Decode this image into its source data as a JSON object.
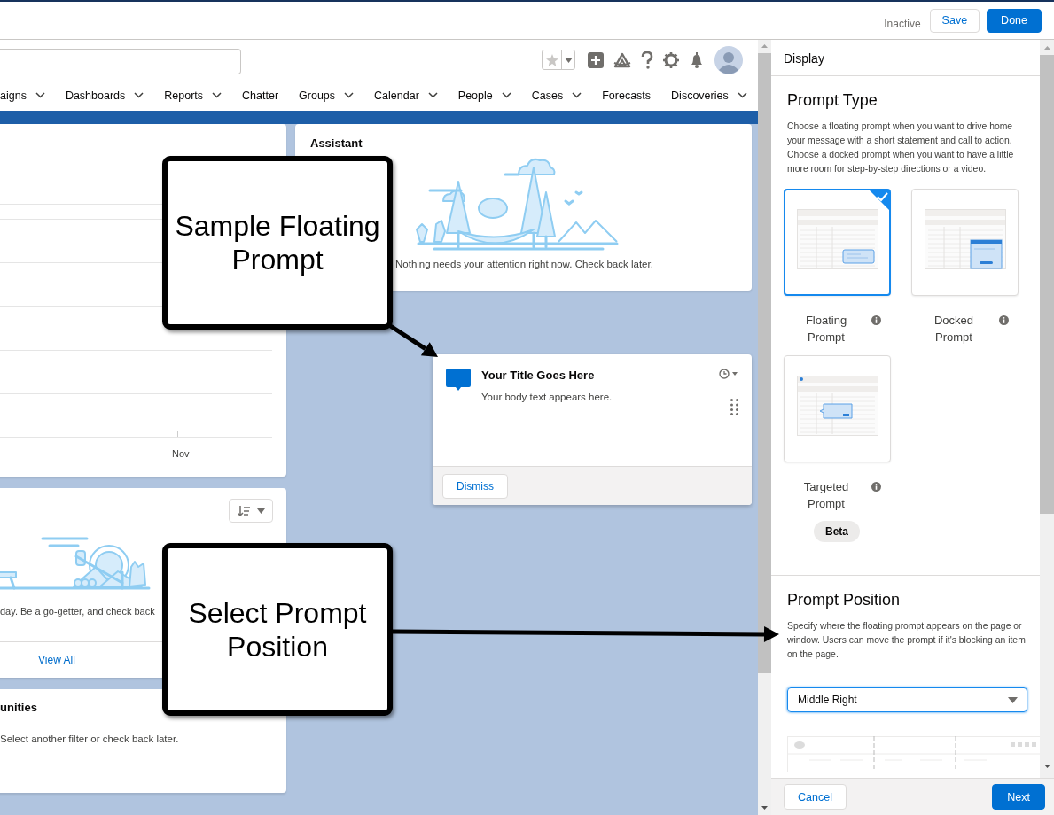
{
  "top_bar": {
    "status": "Inactive",
    "buttons": [
      {
        "label": "Save",
        "kind": "secondary"
      },
      {
        "label": "Done",
        "kind": "primary"
      }
    ]
  },
  "app_preview": {
    "nav_items": [
      {
        "label": "aigns",
        "has_menu": true
      },
      {
        "label": "Dashboards",
        "has_menu": true
      },
      {
        "label": "Reports",
        "has_menu": true
      },
      {
        "label": "Chatter",
        "has_menu": false
      },
      {
        "label": "Groups",
        "has_menu": true
      },
      {
        "label": "Calendar",
        "has_menu": true
      },
      {
        "label": "People",
        "has_menu": true
      },
      {
        "label": "Cases",
        "has_menu": true
      },
      {
        "label": "Forecasts",
        "has_menu": false
      },
      {
        "label": "Discoveries",
        "has_menu": true
      }
    ],
    "cards": [
      {
        "kind": "chart",
        "axis_label": "Nov"
      },
      {
        "kind": "empty",
        "text": "day. Be a go-getter, and check back",
        "link": "View All"
      },
      {
        "kind": "list",
        "title": "unities",
        "text": "Select another filter or check back later."
      }
    ],
    "assistant": {
      "title": "Assistant",
      "message": "Nothing needs your attention right now. Check back later."
    },
    "sample_prompt": {
      "title": "Your Title Goes Here",
      "body": "Your body text appears here.",
      "button": "Dismiss"
    }
  },
  "panel": {
    "section": "Display",
    "prompt_type": {
      "heading": "Prompt Type",
      "description": "Choose a floating prompt when you want to drive home your message with a short statement and call to action. Choose a docked prompt when you want to have a little more room for step-by-step directions or a video.",
      "options": [
        {
          "label": "Floating Prompt",
          "kind": "floating",
          "selected": true
        },
        {
          "label": "Docked Prompt",
          "kind": "docked",
          "selected": false
        },
        {
          "label": "Targeted Prompt",
          "kind": "targeted",
          "selected": false,
          "badge": "Beta"
        }
      ]
    },
    "prompt_position": {
      "heading": "Prompt Position",
      "description": "Specify where the floating prompt appears on the page or window. Users can move the prompt if it's blocking an item on the page.",
      "value": "Middle Right"
    },
    "buttons": [
      {
        "label": "Cancel",
        "kind": "secondary"
      },
      {
        "label": "Next",
        "kind": "primary"
      }
    ]
  },
  "callouts": [
    {
      "text": "Sample Floating Prompt"
    },
    {
      "text": "Select Prompt Position"
    }
  ]
}
